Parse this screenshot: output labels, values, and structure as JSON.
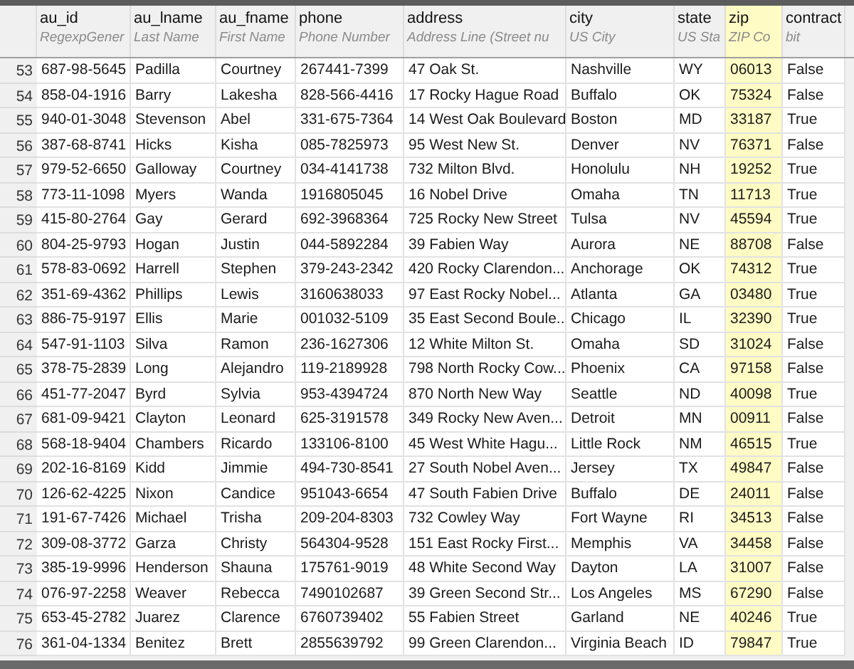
{
  "columns": [
    {
      "name": "au_id",
      "description": "RegexpGener",
      "selected": false
    },
    {
      "name": "au_lname",
      "description": "Last Name",
      "selected": false
    },
    {
      "name": "au_fname",
      "description": "First Name",
      "selected": false
    },
    {
      "name": "phone",
      "description": "Phone Number",
      "selected": false
    },
    {
      "name": "address",
      "description": "Address Line (Street nu",
      "selected": false
    },
    {
      "name": "city",
      "description": "US City",
      "selected": false
    },
    {
      "name": "state",
      "description": "US Sta",
      "selected": false
    },
    {
      "name": "zip",
      "description": "ZIP Co",
      "selected": true
    },
    {
      "name": "contract",
      "description": "bit",
      "selected": false
    }
  ],
  "rows": [
    {
      "number": "53",
      "cells": [
        "687-98-5645",
        "Padilla",
        "Courtney",
        "267441-7399",
        "47 Oak St.",
        "Nashville",
        "WY",
        "06013",
        "False"
      ]
    },
    {
      "number": "54",
      "cells": [
        "858-04-1916",
        "Barry",
        "Lakesha",
        "828-566-4416",
        "17 Rocky Hague Road",
        "Buffalo",
        "OK",
        "75324",
        "False"
      ]
    },
    {
      "number": "55",
      "cells": [
        "940-01-3048",
        "Stevenson",
        "Abel",
        "331-675-7364",
        "14 West Oak Boulevard",
        "Boston",
        "MD",
        "33187",
        "True"
      ]
    },
    {
      "number": "56",
      "cells": [
        "387-68-8741",
        "Hicks",
        "Kisha",
        "085-7825973",
        "95 West New St.",
        "Denver",
        "NV",
        "76371",
        "False"
      ]
    },
    {
      "number": "57",
      "cells": [
        "979-52-6650",
        "Galloway",
        "Courtney",
        "034-4141738",
        "732 Milton Blvd.",
        "Honolulu",
        "NH",
        "19252",
        "True"
      ]
    },
    {
      "number": "58",
      "cells": [
        "773-11-1098",
        "Myers",
        "Wanda",
        "1916805045",
        "16 Nobel Drive",
        "Omaha",
        "TN",
        "11713",
        "True"
      ]
    },
    {
      "number": "59",
      "cells": [
        "415-80-2764",
        "Gay",
        "Gerard",
        "692-3968364",
        "725 Rocky New Street",
        "Tulsa",
        "NV",
        "45594",
        "True"
      ]
    },
    {
      "number": "60",
      "cells": [
        "804-25-9793",
        "Hogan",
        "Justin",
        "044-5892284",
        "39 Fabien Way",
        "Aurora",
        "NE",
        "88708",
        "False"
      ]
    },
    {
      "number": "61",
      "cells": [
        "578-83-0692",
        "Harrell",
        "Stephen",
        "379-243-2342",
        "420 Rocky Clarendon...",
        "Anchorage",
        "OK",
        "74312",
        "True"
      ]
    },
    {
      "number": "62",
      "cells": [
        "351-69-4362",
        "Phillips",
        "Lewis",
        "3160638033",
        "97 East Rocky Nobel...",
        "Atlanta",
        "GA",
        "03480",
        "True"
      ]
    },
    {
      "number": "63",
      "cells": [
        "886-75-9197",
        "Ellis",
        "Marie",
        "001032-5109",
        "35 East Second Boule...",
        "Chicago",
        "IL",
        "32390",
        "True"
      ]
    },
    {
      "number": "64",
      "cells": [
        "547-91-1103",
        "Silva",
        "Ramon",
        "236-1627306",
        "12 White Milton St.",
        "Omaha",
        "SD",
        "31024",
        "False"
      ]
    },
    {
      "number": "65",
      "cells": [
        "378-75-2839",
        "Long",
        "Alejandro",
        "119-2189928",
        "798 North Rocky Cow...",
        "Phoenix",
        "CA",
        "97158",
        "False"
      ]
    },
    {
      "number": "66",
      "cells": [
        "451-77-2047",
        "Byrd",
        "Sylvia",
        "953-4394724",
        "870 North New Way",
        "Seattle",
        "ND",
        "40098",
        "True"
      ]
    },
    {
      "number": "67",
      "cells": [
        "681-09-9421",
        "Clayton",
        "Leonard",
        "625-3191578",
        "349 Rocky New Aven...",
        "Detroit",
        "MN",
        "00911",
        "False"
      ]
    },
    {
      "number": "68",
      "cells": [
        "568-18-9404",
        "Chambers",
        "Ricardo",
        "133106-8100",
        "45 West White Hagu...",
        "Little Rock",
        "NM",
        "46515",
        "True"
      ]
    },
    {
      "number": "69",
      "cells": [
        "202-16-8169",
        "Kidd",
        "Jimmie",
        "494-730-8541",
        "27 South Nobel Aven...",
        "Jersey",
        "TX",
        "49847",
        "False"
      ]
    },
    {
      "number": "70",
      "cells": [
        "126-62-4225",
        "Nixon",
        "Candice",
        "951043-6654",
        "47 South Fabien Drive",
        "Buffalo",
        "DE",
        "24011",
        "False"
      ]
    },
    {
      "number": "71",
      "cells": [
        "191-67-7426",
        "Michael",
        "Trisha",
        "209-204-8303",
        "732 Cowley Way",
        "Fort Wayne",
        "RI",
        "34513",
        "False"
      ]
    },
    {
      "number": "72",
      "cells": [
        "309-08-3772",
        "Garza",
        "Christy",
        "564304-9528",
        "151 East Rocky First...",
        "Memphis",
        "VA",
        "34458",
        "False"
      ]
    },
    {
      "number": "73",
      "cells": [
        "385-19-9996",
        "Henderson",
        "Shauna",
        "175761-9019",
        "48 White Second Way",
        "Dayton",
        "LA",
        "31007",
        "False"
      ]
    },
    {
      "number": "74",
      "cells": [
        "076-97-2258",
        "Weaver",
        "Rebecca",
        "7490102687",
        "39 Green Second Str...",
        "Los Angeles",
        "MS",
        "67290",
        "False"
      ]
    },
    {
      "number": "75",
      "cells": [
        "653-45-2782",
        "Juarez",
        "Clarence",
        "6760739402",
        "55 Fabien Street",
        "Garland",
        "NE",
        "40246",
        "True"
      ]
    },
    {
      "number": "76",
      "cells": [
        "361-04-1334",
        "Benitez",
        "Brett",
        "2855639792",
        "99 Green Clarendon...",
        "Virginia Beach",
        "ID",
        "79847",
        "True"
      ]
    }
  ]
}
